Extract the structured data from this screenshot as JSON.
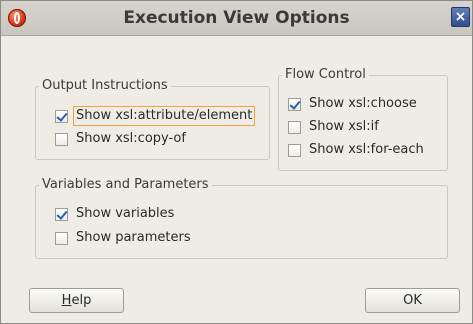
{
  "window": {
    "title": "Execution View Options",
    "close_glyph": "×",
    "app_icon": "oracle-logo-icon"
  },
  "output_instructions": {
    "title": "Output Instructions",
    "items": [
      {
        "label": "Show xsl:attribute/element",
        "checked": true,
        "focused": true
      },
      {
        "label": "Show xsl:copy-of",
        "checked": false,
        "focused": false
      }
    ]
  },
  "flow_control": {
    "title": "Flow Control",
    "items": [
      {
        "label": "Show xsl:choose",
        "checked": true
      },
      {
        "label": "Show xsl:if",
        "checked": false
      },
      {
        "label": "Show xsl:for-each",
        "checked": false
      }
    ]
  },
  "variables_parameters": {
    "title": "Variables and Parameters",
    "items": [
      {
        "label": "Show variables",
        "checked": true
      },
      {
        "label": "Show parameters",
        "checked": false
      }
    ]
  },
  "buttons": {
    "help_mnemonic": "H",
    "help_rest": "elp",
    "ok": "OK"
  }
}
